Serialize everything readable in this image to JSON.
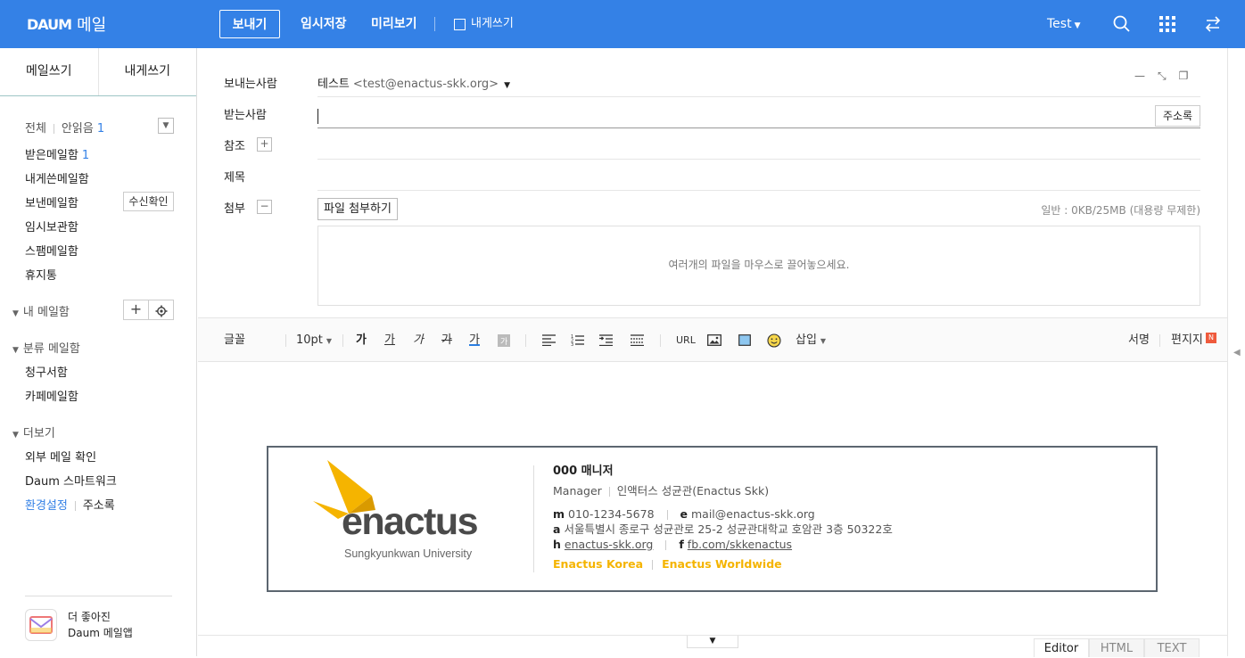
{
  "topbar": {
    "logo_brand": "DAUM",
    "logo_service": "메일",
    "send": "보내기",
    "save_draft": "임시저장",
    "preview": "미리보기",
    "self_mail": "내게쓰기",
    "user": "Test",
    "bg_color": "#3481e6"
  },
  "sidebar": {
    "tab_write": "메일쓰기",
    "tab_self": "내게쓰기",
    "all": "전체",
    "unread": "안읽음",
    "unread_count": "1",
    "inbox": "받은메일함",
    "inbox_count": "1",
    "self_box": "내게쓴메일함",
    "sent": "보낸메일함",
    "receipt_btn": "수신확인",
    "drafts": "임시보관함",
    "spam": "스팸메일함",
    "trash": "휴지통",
    "my_boxes": "내 메일함",
    "categories": "분류 메일함",
    "bills": "청구서함",
    "cafe": "카페메일함",
    "more": "더보기",
    "external": "외부 메일 확인",
    "smartwork": "Daum 스마트워크",
    "settings": "환경설정",
    "address_book": "주소록",
    "promo_line1": "더 좋아진",
    "promo_line2": "Daum 메일앱"
  },
  "compose": {
    "from_label": "보내는사람",
    "from_name": "테스트",
    "from_addr": "<test@enactus-skk.org>",
    "to_label": "받는사람",
    "to_value": "",
    "address_book_btn": "주소록",
    "cc_label": "참조",
    "subject_label": "제목",
    "attach_label": "첨부",
    "attach_btn": "파일 첨부하기",
    "quota": "일반 : 0KB/25MB (대용량 무제한)",
    "dropzone": "여러개의 파일을 마우스로 끌어놓으세요."
  },
  "toolbar": {
    "font": "글꼴",
    "size": "10pt",
    "bold": "가",
    "underline": "가",
    "italic": "가",
    "strike": "가",
    "color": "가",
    "url": "URL",
    "insert": "삽입",
    "signature": "서명",
    "stationery": "편지지",
    "new_badge": "N"
  },
  "signature": {
    "logo_word": "enactus",
    "logo_sub": "Sungkyunkwan University",
    "name": "000 매니저",
    "role": "Manager",
    "org": "인액터스 성균관(Enactus Skk)",
    "m_key": "m",
    "m_val": "010-1234-5678",
    "e_key": "e",
    "e_val": "mail@enactus-skk.org",
    "a_key": "a",
    "a_val": "서울특별시 종로구 성균관로 25-2 성균관대학교 호암관 3층 50322호",
    "h_key": "h",
    "h_val": "enactus-skk.org",
    "f_key": "f",
    "f_val": "fb.com/skkenactus",
    "link1": "Enactus Korea",
    "link2": "Enactus Worldwide",
    "accent": "#f5b400"
  },
  "modes": {
    "editor": "Editor",
    "html": "HTML",
    "text": "TEXT"
  }
}
